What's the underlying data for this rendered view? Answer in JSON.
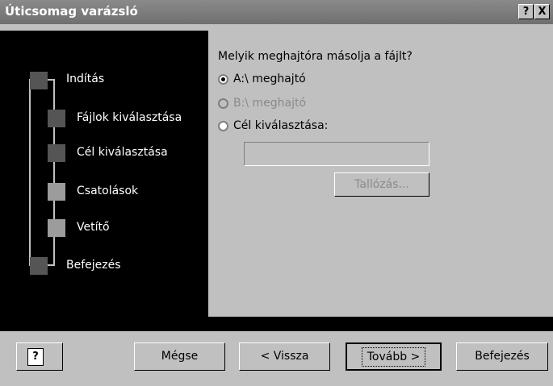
{
  "window": {
    "title": "Úticsomag varázsló"
  },
  "titlebar_buttons": {
    "help": "?",
    "close": "X"
  },
  "steps": [
    {
      "label": "Indítás"
    },
    {
      "label": "Fájlok kiválasztása"
    },
    {
      "label": "Cél kiválasztása"
    },
    {
      "label": "Csatolások"
    },
    {
      "label": "Vetítő"
    },
    {
      "label": "Befejezés"
    }
  ],
  "colors": {
    "step_marker_dark": "#555555",
    "step_marker_light": "#9c9c9c",
    "panel_black": "#000000",
    "dialog_grey": "#c0c0c0",
    "titlebar_grey": "#7c7c7c",
    "disabled_grey": "#8a8a8a"
  },
  "content": {
    "question": "Melyik meghajtóra másolja a fájlt?",
    "options": [
      {
        "label": "A:\\ meghajtó",
        "checked": true,
        "disabled": false
      },
      {
        "label": "B:\\ meghajtó",
        "checked": false,
        "disabled": true
      },
      {
        "label": "Cél kiválasztása:",
        "checked": false,
        "disabled": false
      }
    ],
    "target_field": {
      "value": ""
    },
    "browse_label": "Tallózás..."
  },
  "buttons": {
    "help_icon": "?",
    "cancel": "Mégse",
    "back": "< Vissza",
    "next": "Tovább >",
    "finish": "Befejezés"
  }
}
